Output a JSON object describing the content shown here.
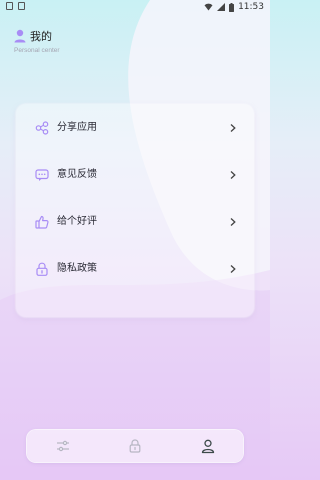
{
  "status_bar": {
    "time": "11:53"
  },
  "header": {
    "title": "我的",
    "subtitle": "Personal center"
  },
  "menu": [
    {
      "label": "分享应用",
      "icon": "share-icon"
    },
    {
      "label": "意见反馈",
      "icon": "feedback-icon"
    },
    {
      "label": "给个好评",
      "icon": "thumbs-up-icon"
    },
    {
      "label": "隐私政策",
      "icon": "lock-icon"
    }
  ],
  "tabs": [
    {
      "icon": "sliders-icon",
      "active": false
    },
    {
      "icon": "lock-icon",
      "active": false
    },
    {
      "icon": "user-icon",
      "active": true
    }
  ],
  "colors": {
    "accent": "#a88cf5",
    "text": "#2a2a35",
    "subtitle": "#a5a5b2"
  }
}
